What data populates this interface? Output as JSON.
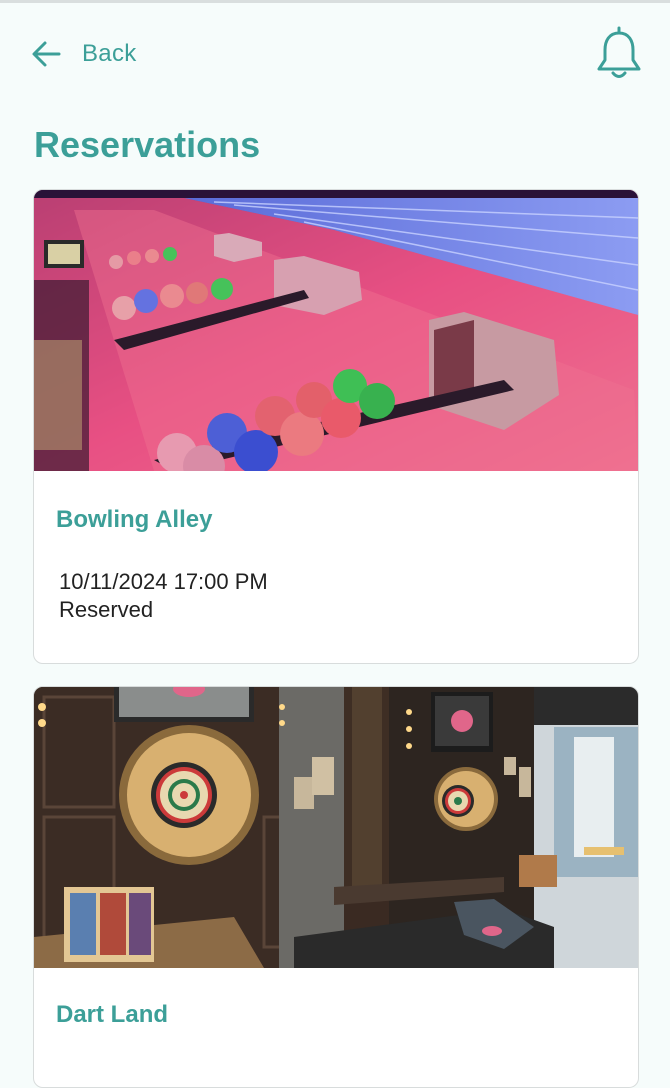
{
  "header": {
    "back_label": "Back",
    "icons": {
      "back": "arrow-left-icon",
      "notifications": "bell-icon"
    }
  },
  "page": {
    "title": "Reservations"
  },
  "reservations": [
    {
      "name": "Bowling Alley",
      "datetime": "10/11/2024 17:00 PM",
      "status": "Reserved",
      "image": "bowling-lanes-photo"
    },
    {
      "name": "Dart Land",
      "image": "dartboards-bar-photo"
    }
  ],
  "colors": {
    "accent": "#3c9f98",
    "background": "#f6fcfb",
    "card": "#ffffff",
    "text": "#222222"
  }
}
